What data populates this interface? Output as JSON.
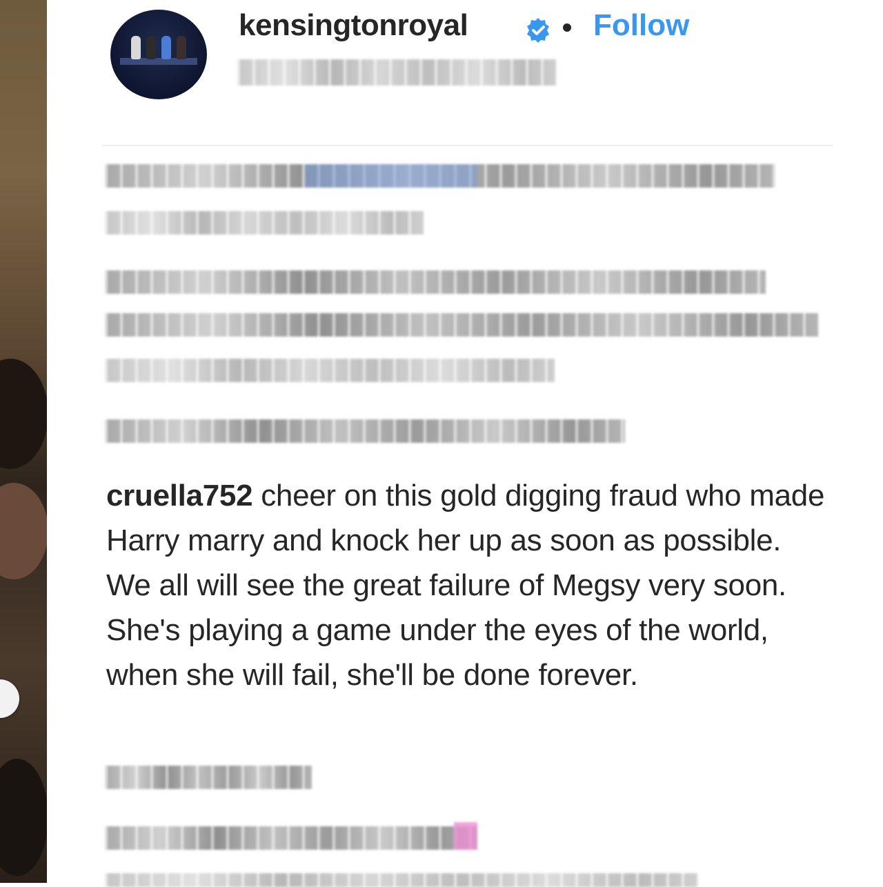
{
  "post": {
    "account_name": "kensingtonroyal",
    "verified": true,
    "separator": "•",
    "follow_label": "Follow"
  },
  "highlighted_comment": {
    "username": "cruella752",
    "text": "cheer on this gold digging fraud who made Harry marry and knock her up as soon as possible. We all will see the great failure of Megsy very soon. She's playing a game under the eyes of the world, when she will fail, she'll be done forever."
  },
  "colors": {
    "link_blue": "#3897f0",
    "text_dark": "#262626",
    "verified_blue": "#3897f0"
  },
  "icons": {
    "verified": "verified-badge-icon",
    "carousel_prev": "circle-button-icon"
  }
}
